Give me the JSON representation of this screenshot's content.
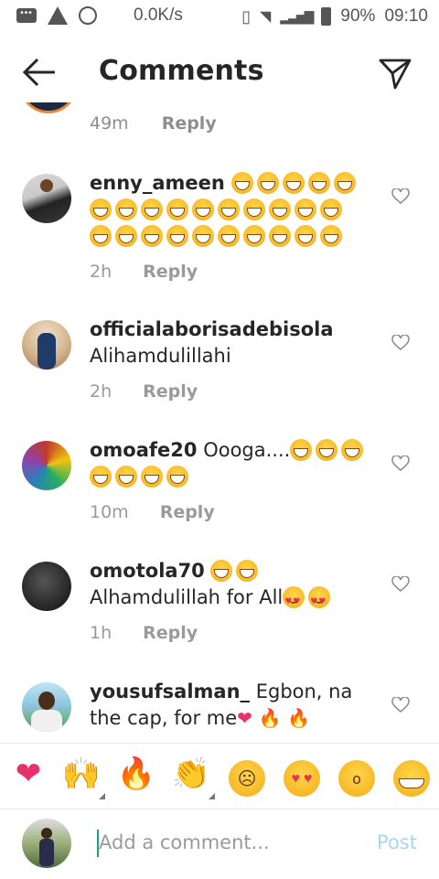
{
  "status_bar": {
    "speed": "0.0K/s",
    "battery": "90%",
    "time": "09:10"
  },
  "header": {
    "title": "Comments"
  },
  "partial": {
    "time": "49m",
    "reply": "Reply"
  },
  "comments": [
    {
      "username": "enny_ameen",
      "text": "",
      "time": "2h",
      "reply": "Reply"
    },
    {
      "username": "officialaborisadebisola",
      "text": "Alihamdulillahi",
      "time": "2h",
      "reply": "Reply"
    },
    {
      "username": "omoafe20",
      "text": "Oooga....",
      "time": "10m",
      "reply": "Reply"
    },
    {
      "username": "omotola70",
      "text": "Alhamdulillah for All",
      "time": "1h",
      "reply": "Reply"
    },
    {
      "username": "yousufsalman_",
      "text": "Egbon, na the cap, for me",
      "time": "",
      "reply": ""
    }
  ],
  "emoji_bar": [
    "heart",
    "raised-hands",
    "fire",
    "clapping-hands",
    "sad-face",
    "heart-eyes-face",
    "surprised-face",
    "grinning-face"
  ],
  "composer": {
    "placeholder": "Add a comment...",
    "post_label": "Post"
  },
  "colors": {
    "story_ring": "#e8893a",
    "post_disabled": "#a9d6f4",
    "heart": "#e8306a",
    "caret": "#1aa085"
  }
}
